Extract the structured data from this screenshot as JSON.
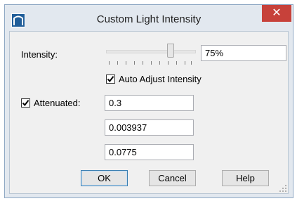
{
  "window": {
    "title": "Custom Light Intensity",
    "icon": "chief-architect-app-icon",
    "close_glyph": "✕"
  },
  "intensity": {
    "label": "Intensity:",
    "slider_level_percent": 75,
    "value": "75%"
  },
  "auto_adjust": {
    "label": "Auto Adjust Intensity",
    "checked": true
  },
  "attenuated": {
    "label": "Attenuated:",
    "checked": true,
    "values": [
      "0.3",
      "0.003937",
      "0.0775"
    ]
  },
  "buttons": {
    "ok": "OK",
    "cancel": "Cancel",
    "help": "Help"
  },
  "colors": {
    "close_button": "#c7413a",
    "frame": "#e2e8ef",
    "default_button_border": "#3c7fb1"
  }
}
